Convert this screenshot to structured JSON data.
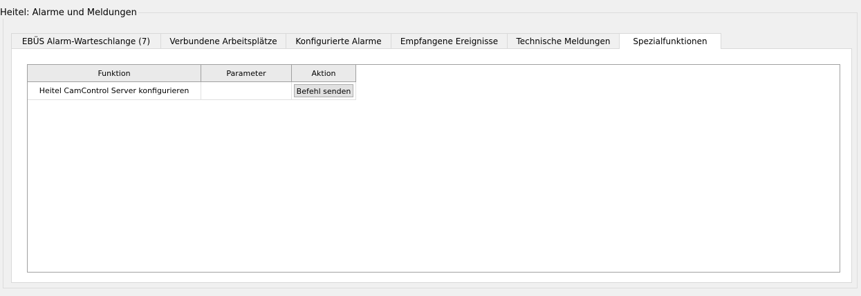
{
  "group": {
    "title": "Heitel: Alarme und Meldungen"
  },
  "tabs": [
    {
      "label": "EBÜS Alarm-Warteschlange (7)"
    },
    {
      "label": "Verbundene Arbeitsplätze"
    },
    {
      "label": "Konfigurierte Alarme"
    },
    {
      "label": "Empfangene Ereignisse"
    },
    {
      "label": "Technische Meldungen"
    },
    {
      "label": "Spezialfunktionen",
      "active": true
    }
  ],
  "table": {
    "columns": [
      "Funktion",
      "Parameter",
      "Aktion"
    ],
    "rows": [
      {
        "funktion": "Heitel CamControl Server konfigurieren",
        "parameter": "",
        "action_label": "Befehl senden"
      }
    ]
  }
}
